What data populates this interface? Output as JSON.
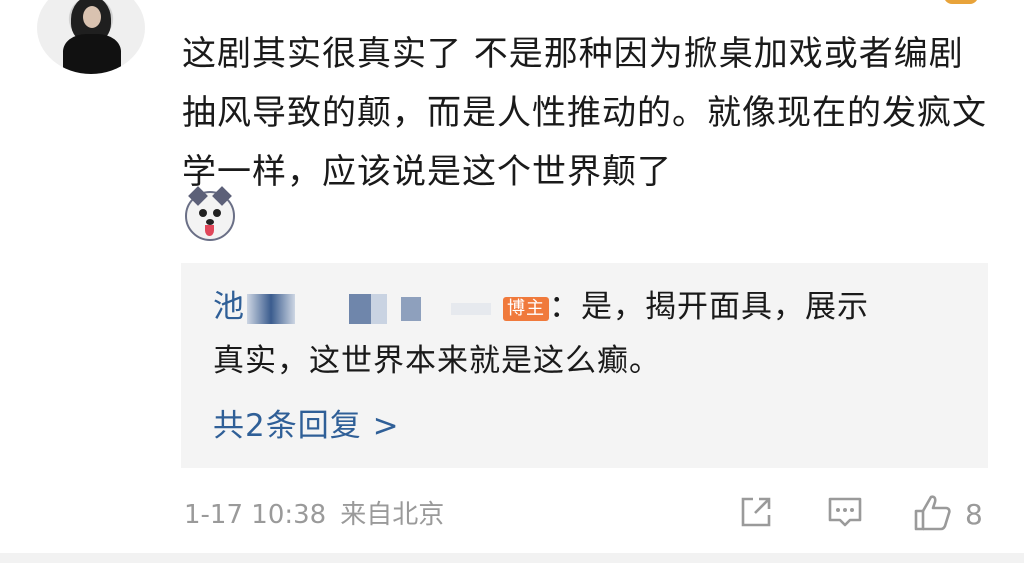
{
  "comment": {
    "text": "这剧其实很真实了 不是那种因为掀桌加戏或者编剧抽风导致的颠，而是人性推动的。就像现在的发疯文学一样，应该说是这个世界颠了",
    "emoji": "husky-emoji"
  },
  "reply": {
    "name_visible": "池",
    "badge": "博主",
    "line1_text": "：是，揭开面具，展示",
    "line2_text": "真实，这世界本来就是这么癫。",
    "more": "共2条回复 >"
  },
  "meta": {
    "time": "1-17 10:38",
    "source": "来自北京",
    "like_count": "8"
  },
  "icons": {
    "share": "share-icon",
    "comment": "comment-icon",
    "like": "like-icon"
  },
  "colors": {
    "link": "#2f5f97",
    "badge": "#f07a3c",
    "meta": "#9a9a9a",
    "reply_bg": "#f4f4f4"
  }
}
